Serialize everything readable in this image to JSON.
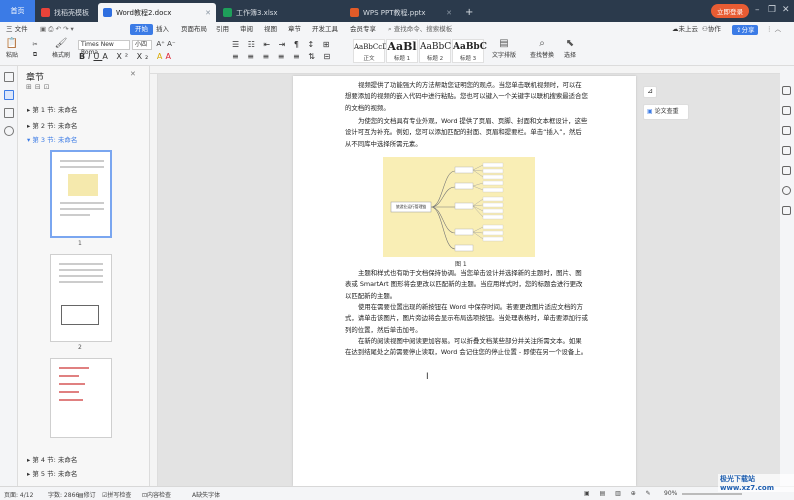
{
  "tabs": {
    "home": "首页",
    "items": [
      {
        "label": "找稻壳模板",
        "color": "#e8433a"
      },
      {
        "label": "Word教程2.docx",
        "color": "#2f6fe0"
      },
      {
        "label": "工作簿3.xlsx",
        "color": "#1e9f5a"
      },
      {
        "label": "WPS PPT教程.pptx",
        "color": "#e25b28"
      }
    ],
    "new_tab": "+",
    "login": "立即登录"
  },
  "menu": {
    "file": "三 文件",
    "items": [
      "开始",
      "插入",
      "页面布局",
      "引用",
      "审阅",
      "视图",
      "章节",
      "开发工具",
      "会员专享"
    ],
    "search": "查找命令、搜索模板",
    "sync": "未上云",
    "collab": "协作",
    "share": "分享"
  },
  "ribbon": {
    "paste": "粘贴",
    "format_painter": "格式刷",
    "font_name": "Times New Roma",
    "font_size": "小四",
    "styles": [
      {
        "sample": "AaBbCcDd",
        "label": "正文"
      },
      {
        "sample": "AaBl",
        "label": "标题 1"
      },
      {
        "sample": "AaBbC",
        "label": "标题 2"
      },
      {
        "sample": "AaBbC",
        "label": "标题 3"
      }
    ],
    "text_layout": "文字排版",
    "find_replace": "查找替换",
    "select": "选择"
  },
  "nav": {
    "title": "章节",
    "sections": [
      {
        "label": "第 1 节: 未命名"
      },
      {
        "label": "第 2 节: 未命名"
      },
      {
        "label": "第 3 节: 未命名"
      }
    ],
    "bottom_sections": [
      {
        "label": "第 4 节: 未命名"
      },
      {
        "label": "第 5 节: 未命名"
      }
    ],
    "pages": [
      "1",
      "2"
    ]
  },
  "doc": {
    "para1": "视频提供了功能强大的方法帮助您证明您的观点。当您单击联机视频时，可以在想要添加的视频的嵌入代码中进行粘贴。您也可以键入一个关键字以联机搜索最适合您的文档的视频。",
    "para2": "为使您的文档具有专业外观，Word 提供了页眉、页脚、封面和文本框设计，这些设计可互为补充。例如，您可以添加匹配的封面、页眉和提要栏。单击“插入”，然后从不同库中选择所需元素。",
    "figure_caption": "图 1",
    "diagram_root": "旅游业运行管理链",
    "para3": "主题和样式也有助于文档保持协调。当您单击设计并选择新的主题时，图片、图表或 SmartArt 图形将会更改以匹配新的主题。当应用样式时，您的标题会进行更改以匹配新的主题。",
    "para4": "使用在需要位置出现的新按钮在 Word 中保存时间。若要更改图片适应文档的方式，请单击该图片，图片旁边将会显示布局选项按钮。当处理表格时，单击要添加行或列的位置，然后单击加号。",
    "para5": "在新的阅读视图中阅读更加容易。可以折叠文档某些部分并关注所需文本。如果在达到结尾处之前需要停止读取，Word 会记住您的停止位置 - 即使在另一个设备上。"
  },
  "side_panel": {
    "label": "论文查重"
  },
  "status": {
    "page": "页面: 4/12",
    "words": "字数: 2866",
    "revise": "修订",
    "spellcheck": "拼写检查",
    "content_check": "内容检查",
    "missing_font": "缺失字体",
    "zoom": "90%"
  },
  "watermark": "极光下载站 www.xz7.com"
}
